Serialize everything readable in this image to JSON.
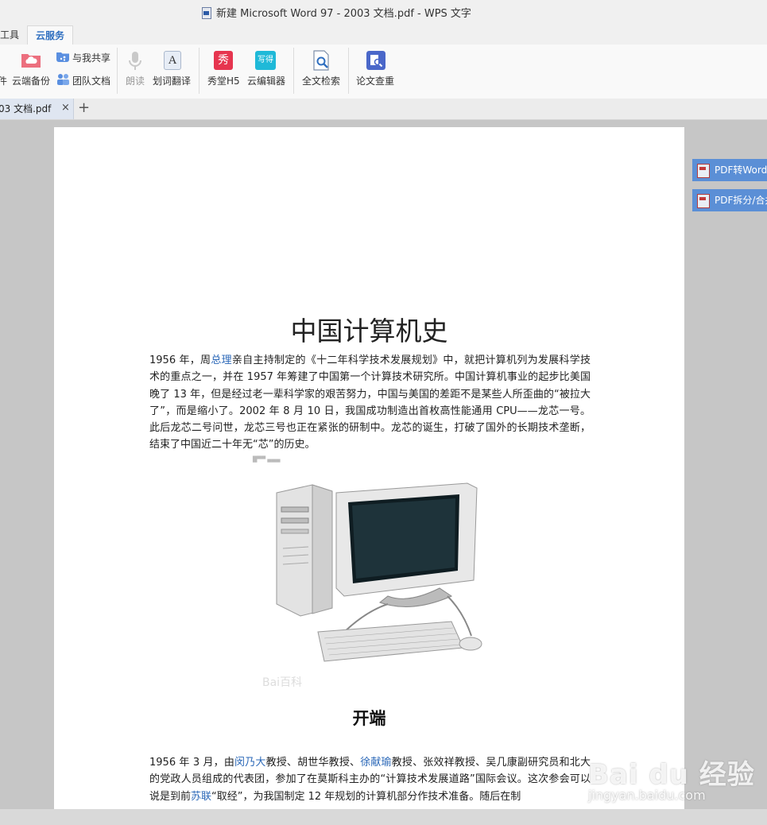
{
  "window": {
    "title": "新建 Microsoft Word 97 - 2003 文档.pdf - WPS 文字"
  },
  "menu": {
    "tools": "工具",
    "cloud": "云服务"
  },
  "ribbon": {
    "partial_left": "件",
    "cloud_backup": "云端备份",
    "share_with_me": "与我共享",
    "team_docs": "团队文档",
    "read_aloud": "朗读",
    "word_translate": "划词翻译",
    "show_h5": "秀堂H5",
    "cloud_editor": "云编辑器",
    "full_search": "全文检索",
    "paper_check": "论文查重",
    "show_glyph": "秀",
    "write_glyph": "写得",
    "translate_glyph": "A"
  },
  "doc_tab": {
    "label": "03 文档.pdf",
    "close": "×",
    "new": "+"
  },
  "side_buttons": {
    "pdf_to_word": "PDF转Word",
    "pdf_split": "PDF拆分/合并"
  },
  "document": {
    "title": "中国计算机史",
    "para1": {
      "p1": "1956 年，周",
      "link1": "总理",
      "p2": "亲自主持制定的《十二年科学技术发展规划》中，就把计算机列为发展科学技术的重点之一，并在 1957 年筹建了中国第一个计算技术研究所。中国计算机事业的起步比美国晚了 13 年，但是经过老一辈科学家的艰苦努力，中国与美国的差距不是某些人所歪曲的“被拉大了”，而是缩小了。2002 年 8 月 10 日，我国成功制造出首枚高性能通用 CPU——龙芯一号。此后龙芯二号问世，龙芯三号也正在紧张的研制中。龙芯的诞生，打破了国外的长期技术垄断，结束了中国近二十年无“芯”的历史。"
    },
    "heading": "开端",
    "para2": {
      "p1": "1956 年 3 月，由",
      "link1": "闵乃大",
      "p2": "教授、胡世华教授、",
      "link2": "徐献瑜",
      "p3": "教授、张效祥教授、吴几康副研究员和北大的党政人员组成的代表团，参加了在莫斯科主办的“计算技术发展道路”国际会议。这次参会可以说是到前",
      "link3": "苏联",
      "p4": "“取经”，为我国制定 12 年规划的计算机部分作技术准备。随后在制"
    }
  },
  "watermark": {
    "brand": "Bai du 经验",
    "url": "jingyan.baidu.com"
  }
}
